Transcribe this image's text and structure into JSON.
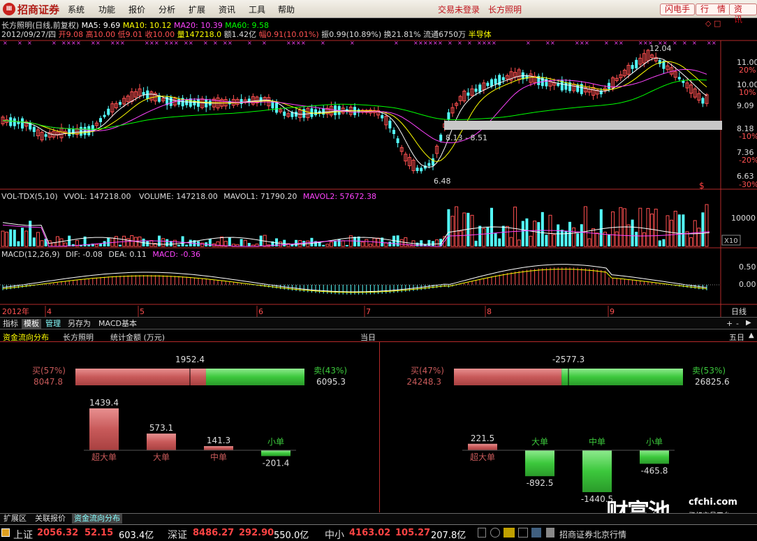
{
  "app": {
    "logo_badge": "Ⅲ",
    "logo_text": "招商证券",
    "menus": [
      "系统",
      "功能",
      "报价",
      "分析",
      "扩展",
      "资讯",
      "工具",
      "帮助"
    ],
    "links": [
      "交易未登录",
      "长方照明"
    ],
    "buttons": [
      "闪电手",
      "行　情",
      "资　讯"
    ]
  },
  "stock_info": {
    "line1": {
      "title": "长方照明(日线,前复权)",
      "ma5": "MA5: 9.69",
      "ma10": "MA10: 10.12",
      "ma20": "MA20: 10.39",
      "ma60": "MA60: 9.58"
    },
    "line2": {
      "date": "2012/09/27/四",
      "open": "开9.08",
      "high": "高10.00",
      "low": "低9.01",
      "close": "收10.00",
      "vol": "量147218.0",
      "amount": "额1.42亿",
      "change": "幅0.91(10.01%)",
      "amplitude": "振0.99(10.89%)",
      "turnover": "换21.81%",
      "float": "流通6750万",
      "sector": "半导体"
    }
  },
  "colors": {
    "up": "#ff5050",
    "down": "#54ffff",
    "ma5": "#ffffff",
    "ma10": "#ffff00",
    "ma20": "#ff44ff",
    "ma60": "#00ff00",
    "panel_border": "#b52a2a",
    "buy_bar": "#c85a5a",
    "sell_bar": "#3cc83c"
  },
  "price_axis": {
    "ticks": [
      "11.00",
      "20%",
      "10.00",
      "10%",
      "9.09",
      "8.18",
      "-10%",
      "7.36",
      "-20%",
      "6.63",
      "-30%"
    ],
    "annotations": [
      "12.04",
      "8.13 - 8.51",
      "6.48"
    ]
  },
  "volume_panel": {
    "label": "VOL-TDX(5,10)",
    "vvol": "VVOL: 147218.00",
    "volume": "VOLUME: 147218.00",
    "mavol1": "MAVOL1: 71790.20",
    "mavol2": "MAVOL2: 57672.38",
    "axis_tick": "10000",
    "unit_badge": "X10"
  },
  "macd_panel": {
    "label": "MACD(12,26,9)",
    "dif": "DIF: -0.08",
    "dea": "DEA: 0.11",
    "macd": "MACD: -0.36",
    "axis_ticks": [
      "0.50",
      "0.00"
    ]
  },
  "time_axis": {
    "labels": [
      "2012年",
      "4",
      "5",
      "6",
      "7",
      "8",
      "9"
    ],
    "period": "日线"
  },
  "tabs": [
    "指标",
    "模板",
    "管理",
    "另存为",
    "MACD基本"
  ],
  "fund_flow": {
    "header_title": "资金流向分布",
    "header_stock": "长方照明",
    "header_metric": "统计金额 (万元)",
    "left_period": "当日",
    "right_period": "五日",
    "left": {
      "net": "1952.4",
      "buy_label": "买(57%)",
      "buy_value": "8047.8",
      "sell_label": "卖(43%)",
      "sell_value": "6095.3",
      "buy_pct": 57,
      "bars": [
        {
          "name": "超大单",
          "value": "1439.4",
          "num": 1439.4
        },
        {
          "name": "大单",
          "value": "573.1",
          "num": 573.1
        },
        {
          "name": "中单",
          "value": "141.3",
          "num": 141.3
        },
        {
          "name": "小单",
          "value": "-201.4",
          "num": -201.4
        }
      ]
    },
    "right": {
      "net": "-2577.3",
      "buy_label": "买(47%)",
      "buy_value": "24248.3",
      "sell_label": "卖(53%)",
      "sell_value": "26825.6",
      "buy_pct": 47,
      "bars": [
        {
          "name": "超大单",
          "value": "221.5",
          "num": 221.5
        },
        {
          "name": "大单",
          "value": "-892.5",
          "num": -892.5
        },
        {
          "name": "中单",
          "value": "-1440.5",
          "num": -1440.5
        },
        {
          "name": "小单",
          "value": "-465.8",
          "num": -465.8
        }
      ]
    }
  },
  "bottom_tabs": [
    "扩展区",
    "关联报价",
    "资金流向分布"
  ],
  "status": {
    "sh_label": "上证",
    "sh_index": "2056.32",
    "sh_change": "52.15",
    "sh_amount": "603.4亿",
    "sz_label": "深证",
    "sz_index": "8486.27",
    "sz_change": "292.90",
    "sz_amount": "550.0亿",
    "zx_label": "中小",
    "zx_index": "4163.02",
    "zx_change": "105.27",
    "zx_amount": "207.8亿",
    "broker": "招商证券北京行情"
  },
  "watermark": {
    "cn": "财富池",
    "domain": "cfchi.com",
    "sub": "指标交易平台"
  }
}
